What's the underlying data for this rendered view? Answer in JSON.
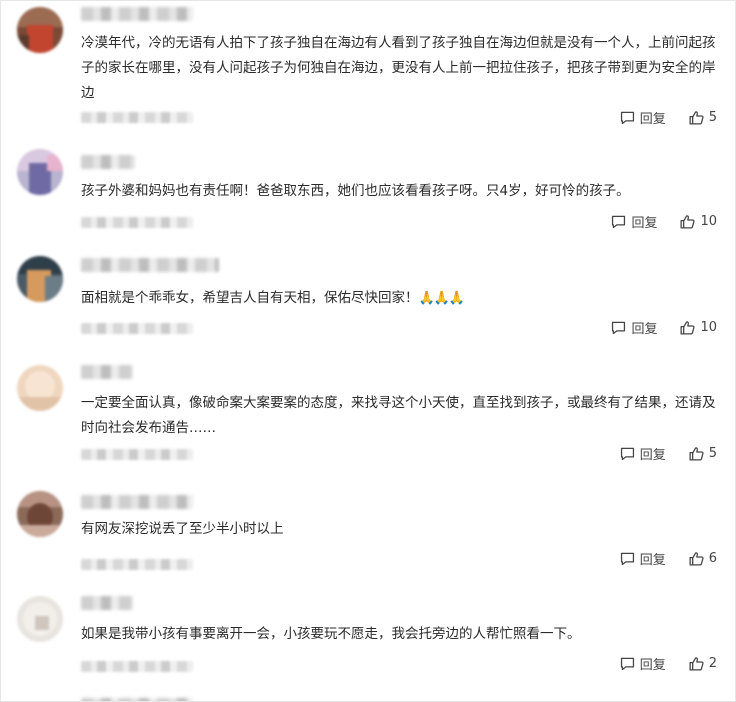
{
  "comments": [
    {
      "text": "冷漠年代，冷的无语有人拍下了孩子独自在海边有人看到了孩子独自在海边但就是没有一个人，上前问起孩子的家长在哪里，没有人问起孩子为何独自在海边，更没有人上前一把拉住孩子，把孩子带到更为安全的岸边",
      "reply_label": "回复",
      "likes": "5"
    },
    {
      "text": "孩子外婆和妈妈也有责任啊！爸爸取东西，她们也应该看看孩子呀。只4岁，好可怜的孩子。",
      "reply_label": "回复",
      "likes": "10"
    },
    {
      "text": "面相就是个乖乖女，希望吉人自有天相，保佑尽快回家！",
      "emoji": "🙏🙏🙏",
      "reply_label": "回复",
      "likes": "10"
    },
    {
      "text": "一定要全面认真，像破命案大案要案的态度，来找寻这个小天使，直至找到孩子，或最终有了结果，还请及时向社会发布通告……",
      "reply_label": "回复",
      "likes": "5"
    },
    {
      "text": "有网友深挖说丢了至少半小时以上",
      "reply_label": "回复",
      "likes": "6"
    },
    {
      "text": "如果是我带小孩有事要离开一会，小孩要玩不愿走，我会托旁边的人帮忙照看一下。",
      "reply_label": "回复",
      "likes": "2"
    }
  ],
  "icons": {
    "reply": "comment-bubble-icon",
    "like": "thumbs-up-icon"
  }
}
